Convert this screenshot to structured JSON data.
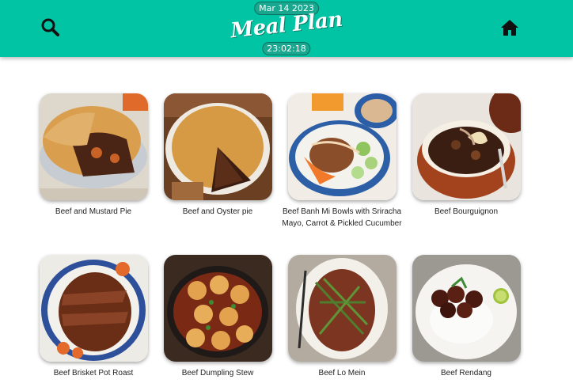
{
  "header": {
    "date": "Mar 14 2023",
    "title": "Meal Plan",
    "time": "23:02:18",
    "search_icon": "search-icon",
    "home_icon": "home-icon",
    "bg_color": "#00c4a3"
  },
  "recipes": [
    {
      "name": "Beef and Mustard Pie"
    },
    {
      "name": "Beef and Oyster pie"
    },
    {
      "name": "Beef Banh Mi Bowls with Sriracha Mayo, Carrot & Pickled Cucumber"
    },
    {
      "name": "Beef Bourguignon"
    },
    {
      "name": "Beef Brisket Pot Roast"
    },
    {
      "name": "Beef Dumpling Stew"
    },
    {
      "name": "Beef Lo Mein"
    },
    {
      "name": "Beef Rendang"
    }
  ]
}
